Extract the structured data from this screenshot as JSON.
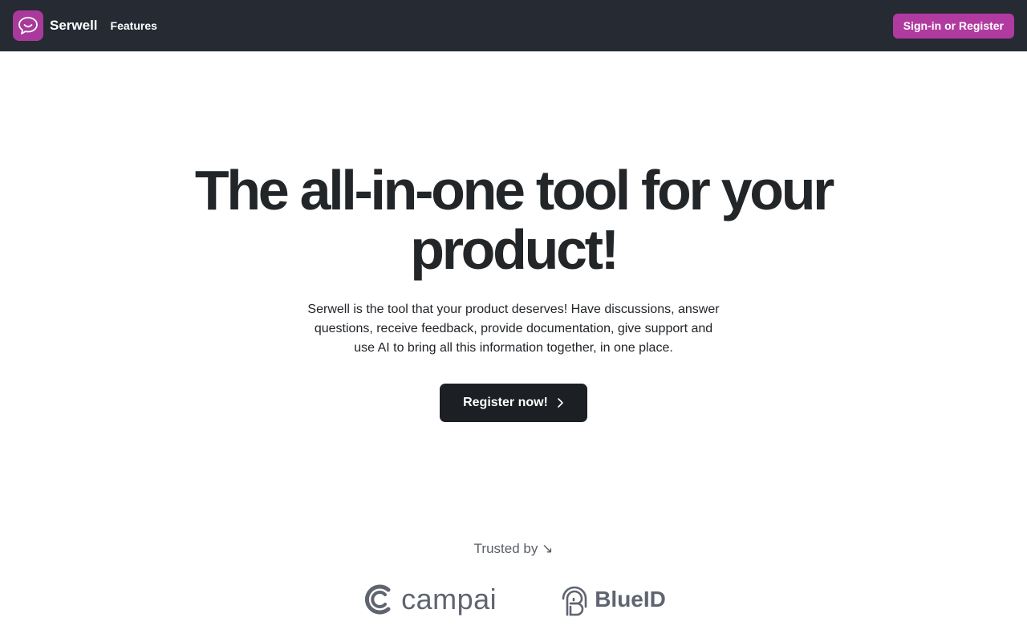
{
  "nav": {
    "brand": "Serwell",
    "features_link": "Features",
    "signin_label": "Sign-in or Register"
  },
  "hero": {
    "title": "The all-in-one tool for your product!",
    "description": "Serwell is the tool that your product deserves! Have discussions, answer questions, receive feedback, provide documentation, give support and use AI to bring all this information together, in one place.",
    "cta_label": "Register now!"
  },
  "trusted": {
    "label": "Trusted by ↘",
    "logos": [
      {
        "name": "campai"
      },
      {
        "name": "BlueID"
      }
    ]
  },
  "icons": {
    "logo": "speech-bubble-smile-icon",
    "cta": "chevron-right-icon",
    "campai": "campai-c-icon",
    "blueid": "blueid-fingerprint-icon"
  },
  "colors": {
    "navbar": "#252a33",
    "brand_accent": "#a93a9b",
    "signin_button": "#b13aa0",
    "cta_button": "#1c1f23",
    "logo_gray": "#5f6470"
  }
}
